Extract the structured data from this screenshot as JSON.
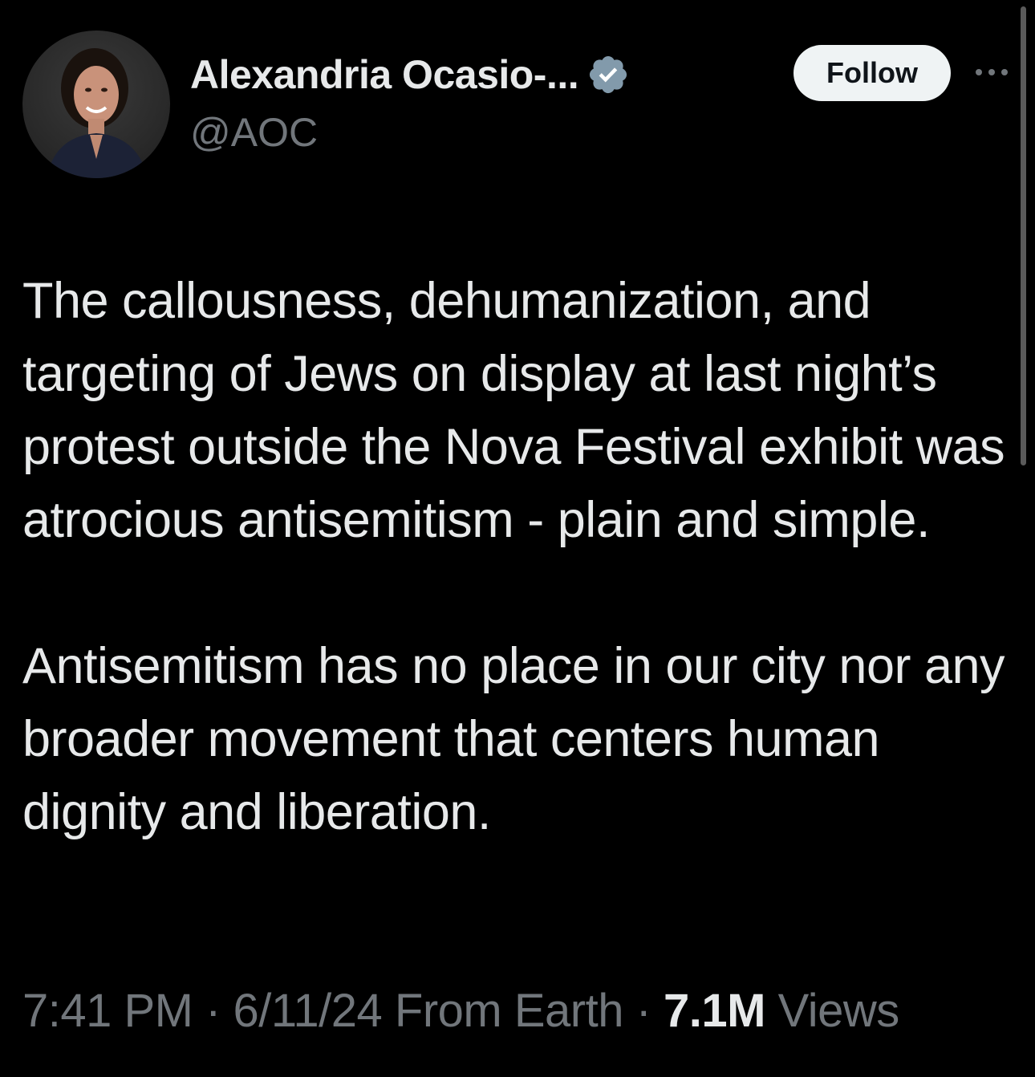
{
  "author": {
    "display_name": "Alexandria Ocasio-...",
    "handle": "@AOC",
    "verified_icon": "verified-badge-icon",
    "badge_color": "#829aab"
  },
  "actions": {
    "follow_label": "Follow",
    "more_icon": "more-horizontal-icon"
  },
  "tweet": {
    "paragraphs": [
      "The callousness, dehumanization, and targeting of Jews on display at last night’s protest outside the Nova Festival exhibit was atrocious antisemitism - plain and simple.",
      "Antisemitism has no place in our city nor any broader movement that centers human dignity and liberation."
    ]
  },
  "meta": {
    "time": "7:41 PM",
    "separator": " · ",
    "date": "6/11/24",
    "source": "From Earth",
    "views_count": "7.1M",
    "views_label": "Views"
  },
  "colors": {
    "background": "#000000",
    "text_primary": "#e7e9ea",
    "text_secondary": "#71767b",
    "follow_bg": "#eff3f4"
  }
}
